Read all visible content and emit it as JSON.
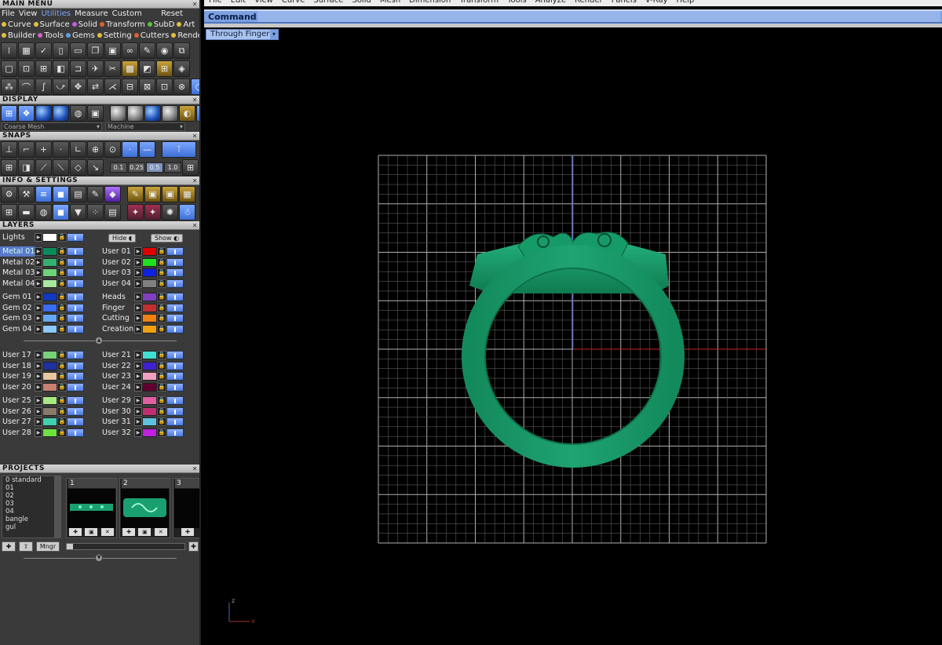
{
  "main_menu": {
    "title": "MAIN MENU",
    "row1": [
      "File",
      "View",
      "Utilities",
      "Measure",
      "Custom"
    ],
    "row1_right": "Reset",
    "row2": [
      {
        "label": "Curve",
        "color": "#e0c040"
      },
      {
        "label": "Surface",
        "color": "#e0c040"
      },
      {
        "label": "Solid",
        "color": "#c060e0"
      },
      {
        "label": "Transform",
        "color": "#e06030"
      },
      {
        "label": "SubD",
        "color": "#60c040"
      },
      {
        "label": "Art",
        "color": "#e0c040"
      }
    ],
    "row3": [
      {
        "label": "Builder",
        "color": "#e0c040"
      },
      {
        "label": "Tools",
        "color": "#d060d0"
      },
      {
        "label": "Gems",
        "color": "#60a0e0"
      },
      {
        "label": "Setting",
        "color": "#e0c040"
      },
      {
        "label": "Cutters",
        "color": "#e06030"
      },
      {
        "label": "Render",
        "color": "#e0c040"
      }
    ]
  },
  "display": {
    "title": "DISPLAY",
    "mesh_dropdown": "Coarse Mesh",
    "material_dropdown": "Machine"
  },
  "snaps": {
    "title": "SNAPS",
    "values": [
      "0.1",
      "0.25",
      "0.5",
      "1.0"
    ]
  },
  "info_settings": {
    "title": "INFO & SETTINGS"
  },
  "layers": {
    "title": "LAYERS",
    "lights_label": "Lights",
    "hide_label": "Hide",
    "show_label": "Show",
    "left_groups": [
      [
        {
          "name": "Metal 01",
          "color": "#0a8a5a",
          "selected": true
        },
        {
          "name": "Metal 02",
          "color": "#36b070"
        },
        {
          "name": "Metal 03",
          "color": "#6fd27a"
        },
        {
          "name": "Metal 04",
          "color": "#a6e8a0"
        }
      ],
      [
        {
          "name": "Gem 01",
          "color": "#1038c0"
        },
        {
          "name": "Gem 02",
          "color": "#3a6cf0"
        },
        {
          "name": "Gem 03",
          "color": "#66a8f8"
        },
        {
          "name": "Gem 04",
          "color": "#8cc8f8"
        }
      ],
      [
        {
          "name": "User 17",
          "color": "#78d078"
        },
        {
          "name": "User 18",
          "color": "#2030a0"
        },
        {
          "name": "User 19",
          "color": "#e8c8a0"
        },
        {
          "name": "User 20",
          "color": "#c88070"
        }
      ],
      [
        {
          "name": "User 25",
          "color": "#a8e880"
        },
        {
          "name": "User 26",
          "color": "#8a7a6a"
        },
        {
          "name": "User 27",
          "color": "#40d0b0"
        },
        {
          "name": "User 28",
          "color": "#70e040"
        }
      ]
    ],
    "right_groups": [
      [
        {
          "name": "User 01",
          "color": "#e00000"
        },
        {
          "name": "User 02",
          "color": "#20e020"
        },
        {
          "name": "User 03",
          "color": "#1020e0"
        },
        {
          "name": "User 04",
          "color": "#808080"
        }
      ],
      [
        {
          "name": "Heads",
          "color": "#8040c0"
        },
        {
          "name": "Finger",
          "color": "#c03030"
        },
        {
          "name": "Cutting",
          "color": "#f08010"
        },
        {
          "name": "Creation",
          "color": "#f0a010"
        }
      ],
      [
        {
          "name": "User 21",
          "color": "#40e0d0"
        },
        {
          "name": "User 22",
          "color": "#4020d0"
        },
        {
          "name": "User 23",
          "color": "#f0a0c0"
        },
        {
          "name": "User 24",
          "color": "#600030"
        }
      ],
      [
        {
          "name": "User 29",
          "color": "#e060a0"
        },
        {
          "name": "User 30",
          "color": "#c03070"
        },
        {
          "name": "User 31",
          "color": "#60c0e0"
        },
        {
          "name": "User 32",
          "color": "#c020e0"
        }
      ]
    ]
  },
  "projects": {
    "title": "PROJECTS",
    "list": [
      "0 standard",
      "01",
      "02",
      "03",
      "04",
      "bangle",
      "gul"
    ],
    "thumbs": [
      "1",
      "2",
      "3"
    ],
    "manager_label": "Mngr"
  },
  "menubar": [
    "File",
    "Edit",
    "View",
    "Curve",
    "Surface",
    "Solid",
    "Mesh",
    "Dimension",
    "Transform",
    "Tools",
    "Analyze",
    "Render",
    "Panels",
    "V-Ray",
    "Help"
  ],
  "command": {
    "label": "Command:",
    "value": ""
  },
  "viewport": {
    "name": "Through Finger",
    "background": "#000000",
    "grid_color": "#8a8a8a",
    "model_color": "#1a9a6a",
    "axis_labels": {
      "z": "z",
      "x": "x"
    }
  }
}
